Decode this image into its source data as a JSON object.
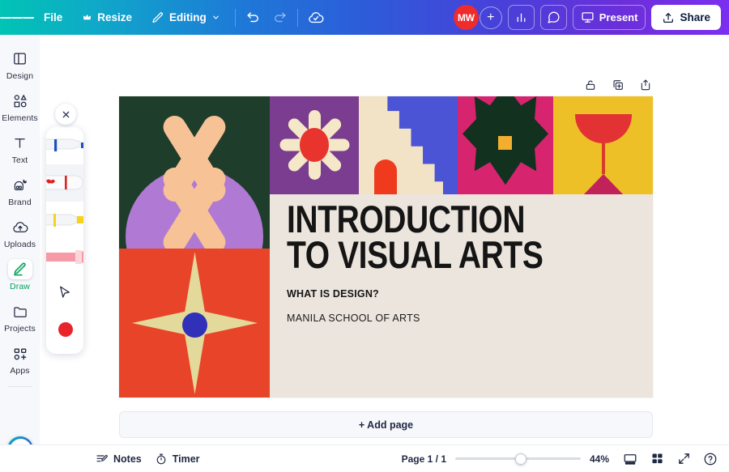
{
  "topbar": {
    "menu_icon": "hamburger-icon",
    "file_label": "File",
    "resize_label": "Resize",
    "resize_icon": "crown-icon",
    "editing_label": "Editing",
    "editing_icon": "pencil-icon",
    "editing_chevron": "chevron-down-icon",
    "undo_icon": "undo-icon",
    "redo_icon": "redo-icon",
    "cloud_icon": "cloud-saved-icon",
    "avatar_initials": "MW",
    "avatar_add": "+",
    "insights_icon": "bar-chart-icon",
    "comment_icon": "comment-icon",
    "present_label": "Present",
    "present_icon": "presentation-icon",
    "share_label": "Share",
    "share_icon": "share-upload-icon"
  },
  "sidebar": {
    "items": [
      {
        "label": "Design",
        "icon": "design-layout-icon",
        "active": false
      },
      {
        "label": "Elements",
        "icon": "elements-shapes-icon",
        "active": false
      },
      {
        "label": "Text",
        "icon": "text-t-icon",
        "active": false
      },
      {
        "label": "Brand",
        "icon": "brand-crown-icon",
        "active": false
      },
      {
        "label": "Uploads",
        "icon": "upload-cloud-icon",
        "active": false
      },
      {
        "label": "Draw",
        "icon": "draw-pen-icon",
        "active": true
      },
      {
        "label": "Projects",
        "icon": "folder-icon",
        "active": false
      },
      {
        "label": "Apps",
        "icon": "apps-grid-icon",
        "active": false
      }
    ],
    "magic_icon": "magic-sparkle-icon"
  },
  "draw_panel": {
    "close_icon": "close-x-icon",
    "tools": [
      {
        "name": "pen-blue",
        "icon": "marker-pen-icon",
        "color": "#1a4fbf",
        "selected": false
      },
      {
        "name": "pen-red",
        "icon": "marker-pen-icon",
        "color": "#e02020",
        "selected": true
      },
      {
        "name": "highlighter-yellow",
        "icon": "highlighter-icon",
        "color": "#f5d21c",
        "selected": false
      },
      {
        "name": "eraser-pink",
        "icon": "eraser-icon",
        "color": "#f7a0a8",
        "selected": false
      },
      {
        "name": "select-cursor",
        "icon": "cursor-arrow-icon",
        "color": "#1f2742",
        "selected": false
      },
      {
        "name": "color-swatch",
        "icon": "color-dot-icon",
        "color": "#e8242a",
        "selected": false
      },
      {
        "name": "stroke-weight",
        "icon": "stroke-lines-icon",
        "color": "#111111",
        "selected": false
      }
    ]
  },
  "canvas_tools": {
    "lock_icon": "lock-open-icon",
    "duplicate_icon": "duplicate-page-icon",
    "add_icon": "add-page-icon"
  },
  "slide": {
    "title_line1": "INTRODUCTION",
    "title_line2": "TO VISUAL ARTS",
    "subtitle": "WHAT IS DESIGN?",
    "organization": "MANILA SCHOOL OF ARTS",
    "background": "#ece5dd",
    "art_panels": [
      {
        "name": "crossed-batons-dome",
        "bg": "#1f3d2b",
        "accent": "#b07ad4",
        "shape": "#f7c296"
      },
      {
        "name": "four-point-star",
        "bg": "#e8442a",
        "accent": "#e3d99a",
        "shape": "#3030b8"
      },
      {
        "name": "daisy-flower",
        "bg": "#7a3d8f",
        "accent": "#f5e8c8",
        "shape": "#e8342c"
      },
      {
        "name": "stepped-wave-arch",
        "bg": "#4a54d4",
        "accent": "#f2e2c6",
        "shape": "#f03a1e"
      },
      {
        "name": "six-petal-flower",
        "bg": "#d6246f",
        "accent": "#13311f",
        "shape": "#f3ae30"
      },
      {
        "name": "red-goblet",
        "bg": "#eec028",
        "accent": "#e33234",
        "shape": "#c1225a"
      }
    ]
  },
  "add_page": {
    "label": "+ Add page"
  },
  "bottombar": {
    "notes_label": "Notes",
    "notes_icon": "notes-icon",
    "timer_label": "Timer",
    "timer_icon": "timer-icon",
    "page_label": "Page 1 / 1",
    "zoom_label": "44%",
    "zoom_value": 44,
    "grid_view_icon": "page-view-icon",
    "thumbnails_icon": "grid-view-icon",
    "fullscreen_icon": "expand-icon",
    "help_icon": "help-circle-icon"
  }
}
